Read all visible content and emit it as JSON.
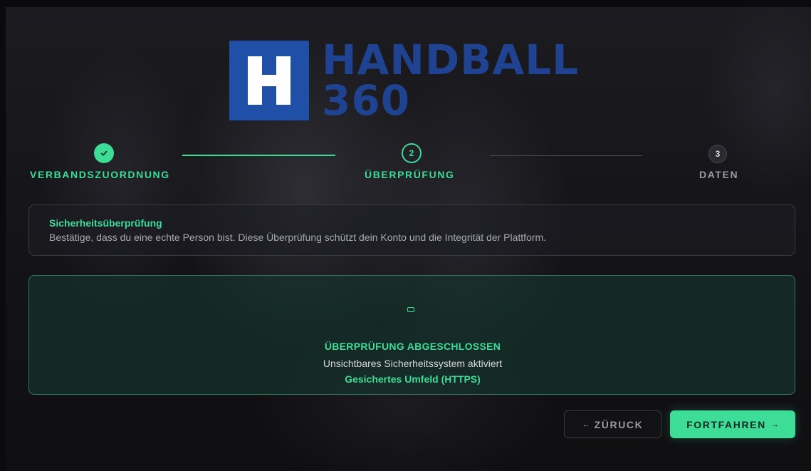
{
  "brand": {
    "word_line1": "HANDBALL",
    "word_line2": "360",
    "colors": {
      "mark": "#1f4fa6",
      "word": "#1f4291",
      "accent": "#3ddc97"
    }
  },
  "stepper": {
    "steps": [
      {
        "number": "1",
        "label": "VERBANDSZUORDNUNG",
        "state": "completed",
        "icon": "check-icon"
      },
      {
        "number": "2",
        "label": "ÜBERPRÜFUNG",
        "state": "active"
      },
      {
        "number": "3",
        "label": "DATEN",
        "state": "pending"
      }
    ]
  },
  "info": {
    "title": "Sicherheitsüberprüfung",
    "text": "Bestätige, dass du eine echte Person bist. Diese Überprüfung schützt dein Konto und die Integrität der Plattform."
  },
  "verification": {
    "icon": "screen-icon",
    "title": "ÜBERPRÜFUNG ABGESCHLOSSEN",
    "subtitle": "Unsichtbares Sicherheitssystem aktiviert",
    "secure_note": "Gesichertes Umfeld (HTTPS)"
  },
  "actions": {
    "back_arrow": "←",
    "back_label": "ZÜRUCK",
    "next_label": "FORTFAHREN",
    "next_arrow": "→"
  }
}
